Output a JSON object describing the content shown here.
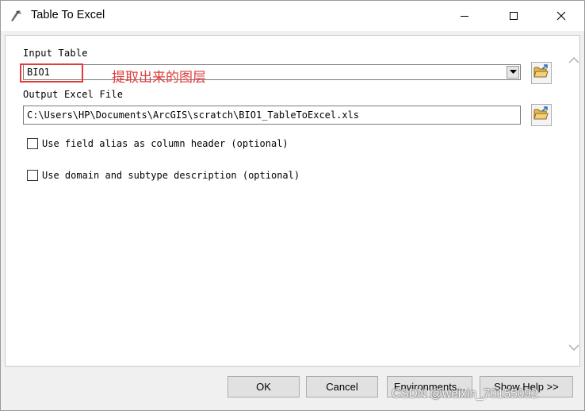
{
  "window": {
    "title": "Table To Excel"
  },
  "form": {
    "input_table_label": "Input Table",
    "input_table_value": "BIO1",
    "output_file_label": "Output Excel File",
    "output_file_value": "C:\\Users\\HP\\Documents\\ArcGIS\\scratch\\BIO1_TableToExcel.xls",
    "option_alias_label": "Use field alias as column header (optional)",
    "option_alias_checked": false,
    "option_domain_label": "Use domain and subtype description (optional)",
    "option_domain_checked": false
  },
  "annotation": {
    "text": "提取出来的图层",
    "color": "#e23b3b"
  },
  "buttons": {
    "ok": "OK",
    "cancel": "Cancel",
    "environments": "Environments...",
    "show_help": "Show Help >>"
  },
  "watermark": "CSDN @weixin_70155092",
  "icons": {
    "app": "toolbox-icon",
    "folder": "open-folder-icon",
    "minimize": "minimize-icon",
    "maximize": "maximize-icon",
    "close": "close-icon"
  }
}
